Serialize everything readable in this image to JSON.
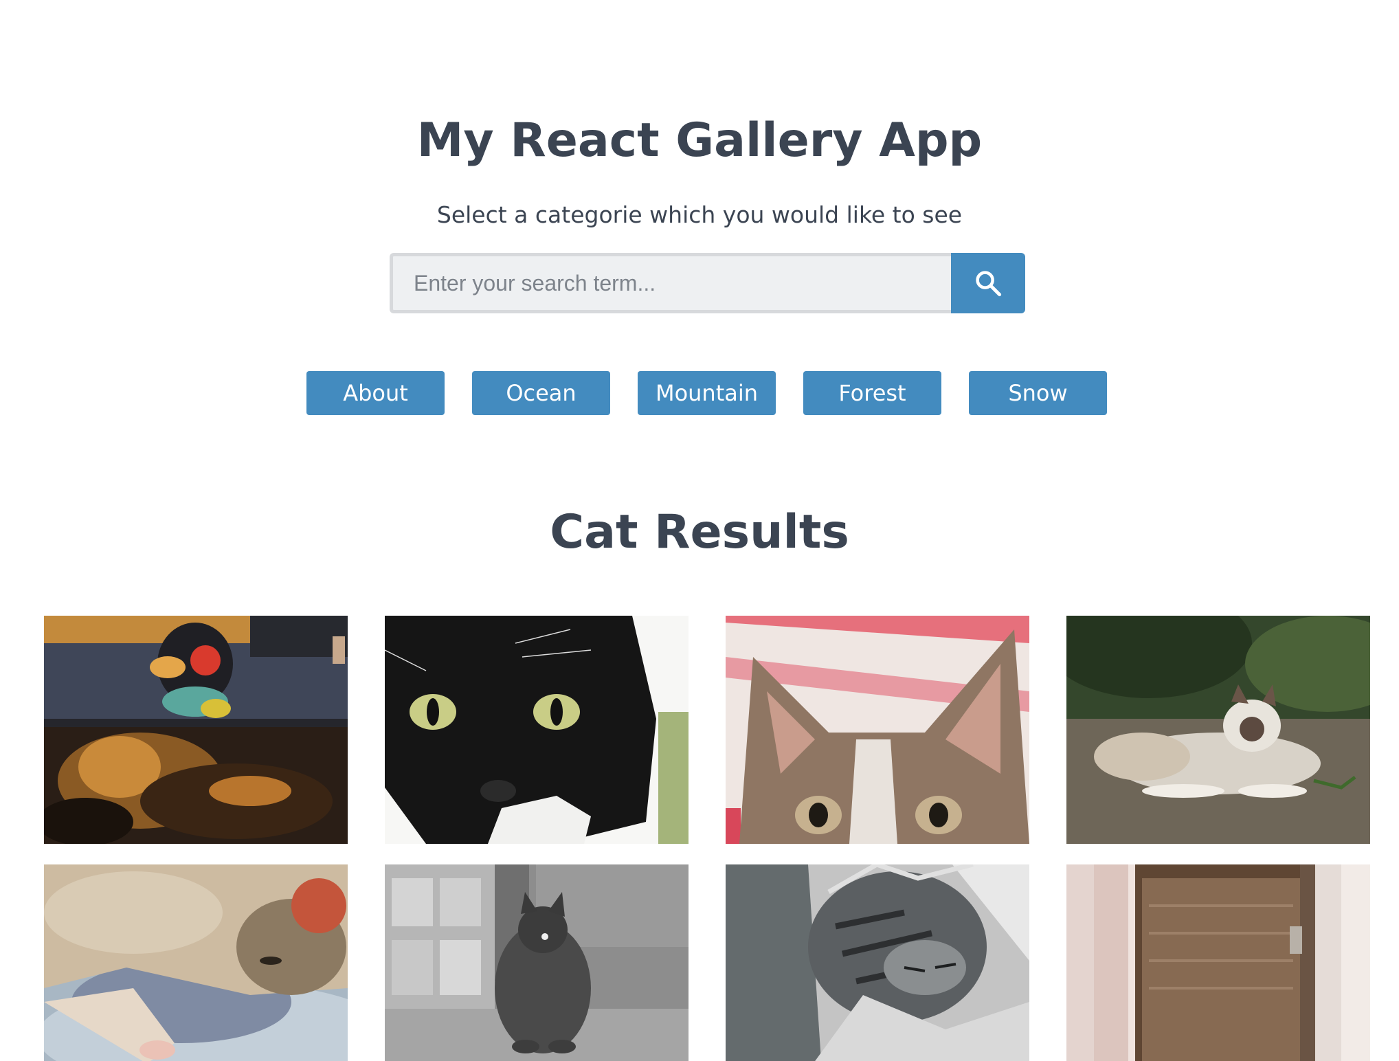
{
  "header": {
    "title": "My React Gallery App",
    "subtitle": "Select a categorie which you would like to see"
  },
  "search": {
    "placeholder": "Enter your search term...",
    "value": "",
    "button_icon": "search-icon"
  },
  "nav": {
    "items": [
      {
        "label": "About"
      },
      {
        "label": "Ocean"
      },
      {
        "label": "Mountain"
      },
      {
        "label": "Forest"
      },
      {
        "label": "Snow"
      }
    ]
  },
  "results": {
    "title": "Cat Results",
    "photos": [
      {
        "subject": "calico cat under plush toy"
      },
      {
        "subject": "black and white cat close-up"
      },
      {
        "subject": "tabby kitten peeking"
      },
      {
        "subject": "siamese cat lying on ground"
      },
      {
        "subject": "cat sleeping on blanket"
      },
      {
        "subject": "tabby cat in grayscale room"
      },
      {
        "subject": "sleeping tabby kitten"
      },
      {
        "subject": "cat by a door"
      }
    ]
  },
  "colors": {
    "accent": "#438bbf",
    "text": "#3b4452",
    "input_bg": "#eef0f2"
  }
}
